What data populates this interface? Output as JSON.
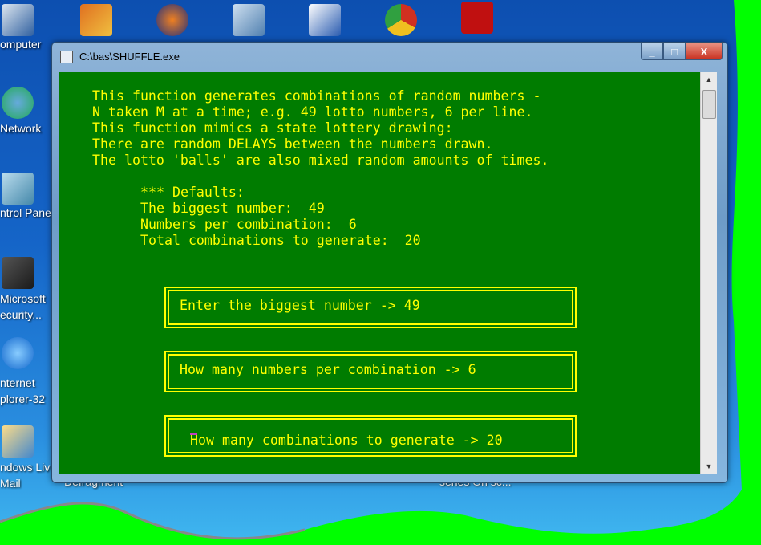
{
  "desktop": {
    "left_icons": [
      {
        "label": "omputer",
        "icon": "computer-icon"
      },
      {
        "label": "Network",
        "icon": "network-icon"
      },
      {
        "label": "ntrol Pane",
        "icon": "control-panel-icon"
      },
      {
        "label": "Microsoft\necurity...",
        "icon": "security-icon"
      },
      {
        "label": "nternet\nplorer-32",
        "icon": "internet-explorer-icon"
      },
      {
        "label": "ndows Liv\nMail",
        "icon": "windows-live-mail-icon"
      }
    ],
    "top_icons": [
      "windows-movie-maker-icon",
      "audacity-icon",
      "spreadsheet-icon",
      "word-icon",
      "chrome-icon",
      "adobe-reader-icon"
    ],
    "hidden_labels": [
      "Defragment",
      "series On sc..."
    ]
  },
  "window": {
    "title": "C:\\bas\\SHUFFLE.exe",
    "minimize": "_",
    "maximize": "□",
    "close": "X"
  },
  "console": {
    "intro": [
      "This function generates combinations of random numbers -",
      "N taken M at a time; e.g. 49 lotto numbers, 6 per line.",
      "This function mimics a state lottery drawing:",
      "There are random DELAYS between the numbers drawn.",
      "The lotto 'balls' are also mixed random amounts of times."
    ],
    "defaults": [
      "*** Defaults:",
      "The biggest number:  49",
      "Numbers per combination:  6",
      "Total combinations to generate:  20"
    ],
    "prompts": [
      "Enter the biggest number -> 49",
      "How many numbers per combination -> 6",
      "How many combinations to generate -> 20"
    ],
    "colors": {
      "background": "#007c00",
      "text": "#ffff00",
      "cursor": "#c040c0"
    }
  }
}
